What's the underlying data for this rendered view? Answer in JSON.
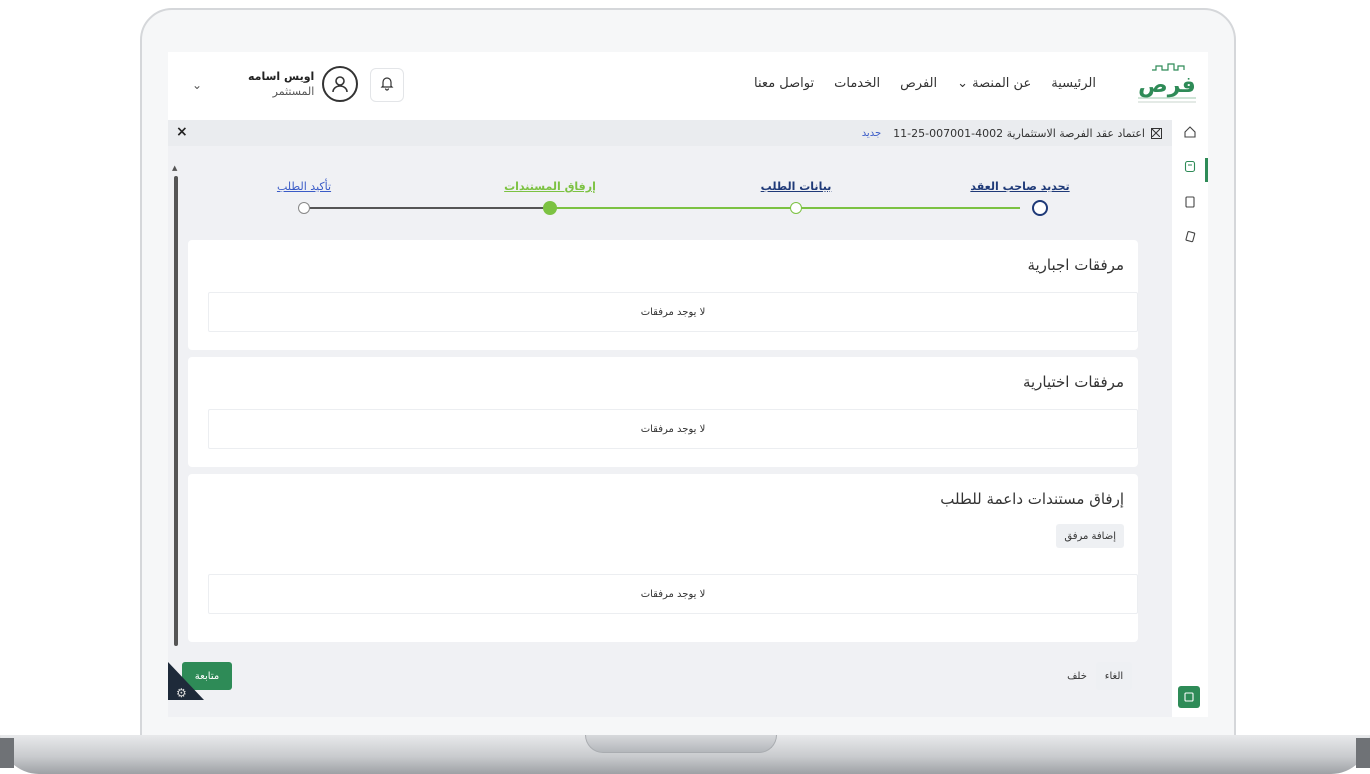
{
  "header": {
    "logo_text": "فرص",
    "nav": [
      {
        "label": "الرئيسية"
      },
      {
        "label": "عن المنصة ⌄"
      },
      {
        "label": "الفرص"
      },
      {
        "label": "الخدمات"
      },
      {
        "label": "تواصل معنا"
      }
    ],
    "user_name": "اويس اسامه",
    "user_role": "المستثمر",
    "bell_icon": "bell-icon",
    "chevron": "⌄"
  },
  "request": {
    "title": "اعتماد عقد الفرصة الاستثمارية 4002-007001-25-11",
    "badge": "جديد",
    "close": "×"
  },
  "stepper": {
    "steps": [
      {
        "label": "تحديد صاحب العقد",
        "state": "current"
      },
      {
        "label": "بيانات الطلب",
        "state": "done"
      },
      {
        "label": "إرفاق المستندات",
        "state": "active"
      },
      {
        "label": "تأكيد الطلب",
        "state": "pending"
      }
    ]
  },
  "sections": {
    "mandatory": {
      "title": "مرفقات اجبارية",
      "empty": "لا يوجد مرفقات"
    },
    "optional": {
      "title": "مرفقات اختيارية",
      "empty": "لا يوجد مرفقات"
    },
    "supporting": {
      "title": "إرفاق مستندات داعمة للطلب",
      "add_button": "إضافة مرفق",
      "empty": "لا يوجد مرفقات"
    }
  },
  "footer": {
    "cancel": "الغاء",
    "back": "خلف",
    "next": "متابعة"
  },
  "colors": {
    "accent": "#2e8b57",
    "step_active": "#7cc242",
    "link_blue": "#3a5bc7"
  }
}
